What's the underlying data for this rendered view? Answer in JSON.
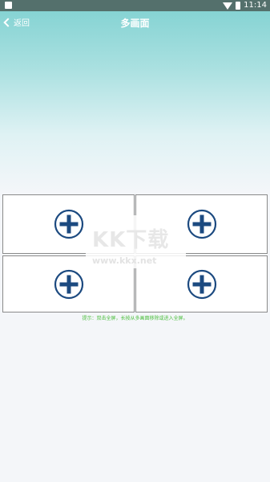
{
  "status_bar": {
    "time": "11:14"
  },
  "nav": {
    "back_label": "返回",
    "title": "多画面"
  },
  "panels": [
    {
      "icon": "plus-circle-icon"
    },
    {
      "icon": "plus-circle-icon"
    },
    {
      "icon": "plus-circle-icon"
    },
    {
      "icon": "plus-circle-icon"
    }
  ],
  "watermark": {
    "logo": "KK下载",
    "url": "www.kkx.net"
  },
  "hint": "提示：双击全屏，长按从多画面移除或进入全屏。",
  "colors": {
    "accent": "#7fd1d1",
    "icon_blue": "#1c4a80",
    "hint_green": "#4cbf3e"
  }
}
